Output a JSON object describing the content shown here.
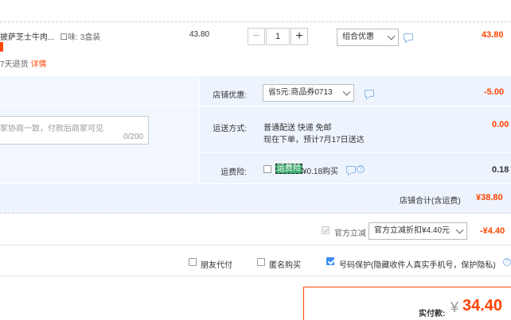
{
  "item": {
    "title": "披萨芝士牛肉...",
    "flavor_label": "口味:",
    "flavor_value": "3盒装",
    "refund_text": "7天退货",
    "detail_link": "详情",
    "unit_price": "43.80",
    "quantity": "1",
    "minus": "−",
    "plus": "+",
    "discount_select": "组合优惠",
    "subtotal": "43.80"
  },
  "shop": {
    "discount_label": "店铺优惠:",
    "discount_select": "省5元:商品券0713",
    "discount_amount": "-5.00",
    "message_placeholder": "家协商一致，付款后商家可见",
    "message_count": "0/200",
    "shipping_label": "运送方式:",
    "shipping_method": "普通配送 快递 免邮",
    "shipping_eta": "现在下单，预计7月17日送达",
    "shipping_fee": "0.00",
    "insurance_label": "运费险:",
    "insurance_tag": "运费险",
    "insurance_price": "¥0.18购买",
    "insurance_amount": "0.18",
    "total_label": "店铺合计(含运费)",
    "total_amount": "¥38.80"
  },
  "official": {
    "checkbox_label": "官方立减",
    "select": "官方立减折扣¥4.40元",
    "amount": "-¥4.40"
  },
  "options": {
    "friend_pay": "朋友代付",
    "anonymous": "匿名购买",
    "privacy": "号码保护",
    "privacy_desc": "(隐藏收件人真实手机号，保护隐私)"
  },
  "payment": {
    "label": "实付款:",
    "currency": "¥",
    "amount": "34.40"
  },
  "colors": {
    "accent": "#ff4400",
    "section_bg": "#eef4fd",
    "checkbox_blue": "#3b8df5"
  }
}
